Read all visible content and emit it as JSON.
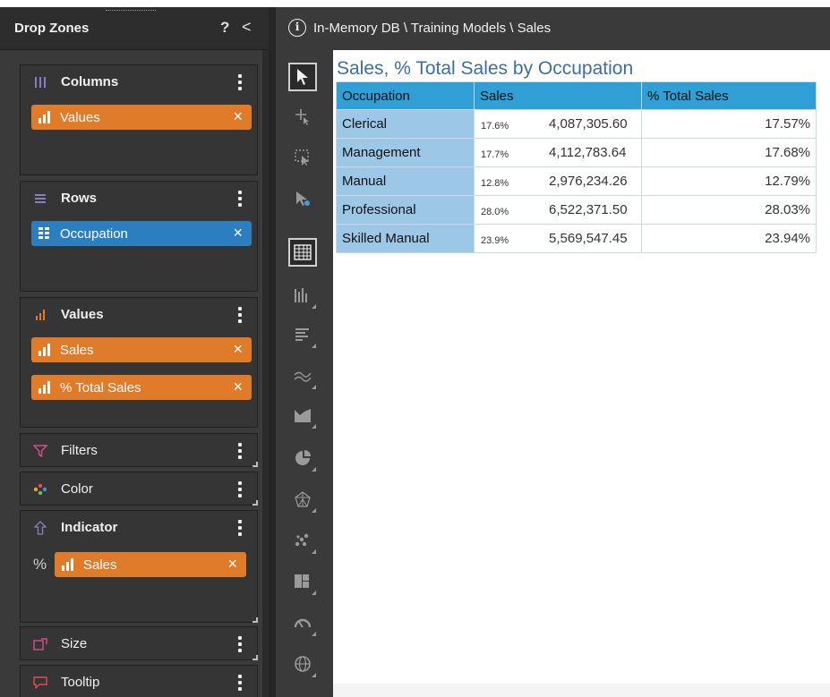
{
  "drop_zones": {
    "title": "Drop Zones",
    "help_label": "?",
    "collapse_label": "<",
    "zones": {
      "columns": {
        "label": "Columns",
        "items": [
          {
            "label": "Values",
            "close": "×"
          }
        ]
      },
      "rows": {
        "label": "Rows",
        "items": [
          {
            "label": "Occupation",
            "close": "×"
          }
        ]
      },
      "values": {
        "label": "Values",
        "items": [
          {
            "label": "Sales",
            "close": "×"
          },
          {
            "label": "% Total Sales",
            "close": "×"
          }
        ]
      },
      "filters": {
        "label": "Filters"
      },
      "color": {
        "label": "Color"
      },
      "indicator": {
        "label": "Indicator",
        "prefix": "%",
        "items": [
          {
            "label": "Sales",
            "close": "×"
          }
        ]
      },
      "size": {
        "label": "Size"
      },
      "tooltip": {
        "label": "Tooltip"
      }
    }
  },
  "topbar": {
    "info_label": "i",
    "breadcrumb": "In-Memory DB \\ Training Models \\ Sales"
  },
  "toolbar": {
    "tools": [
      "select-pointer",
      "add-point",
      "zoom-select",
      "drill-pointer",
      "grid-table",
      "column-chart",
      "bar-chart",
      "line-chart",
      "area-chart",
      "pie-chart",
      "radar-chart",
      "scatter-chart",
      "treemap-chart",
      "gauge-chart",
      "map-globe"
    ],
    "selected": "grid-table"
  },
  "report": {
    "title": "Sales, % Total Sales by Occupation",
    "headers": {
      "occupation": "Occupation",
      "sales": "Sales",
      "pct_total": "% Total Sales"
    },
    "rows": [
      {
        "occupation": "Clerical",
        "indicator": "17.6%",
        "sales": "4,087,305.60",
        "pct_total": "17.57%"
      },
      {
        "occupation": "Management",
        "indicator": "17.7%",
        "sales": "4,112,783.64",
        "pct_total": "17.68%"
      },
      {
        "occupation": "Manual",
        "indicator": "12.8%",
        "sales": "2,976,234.26",
        "pct_total": "12.79%"
      },
      {
        "occupation": "Professional",
        "indicator": "28.0%",
        "sales": "6,522,371.50",
        "pct_total": "28.03%"
      },
      {
        "occupation": "Skilled Manual",
        "indicator": "23.9%",
        "sales": "5,569,547.45",
        "pct_total": "23.94%"
      }
    ]
  },
  "colors": {
    "panel_bg": "#3a3a3a",
    "measure_pill": "#e07b2a",
    "dimension_pill": "#2b7fc0",
    "header_bg": "#2f9fd6",
    "row_header_bg": "#9cc7e6",
    "title_text": "#3b6ea5"
  }
}
